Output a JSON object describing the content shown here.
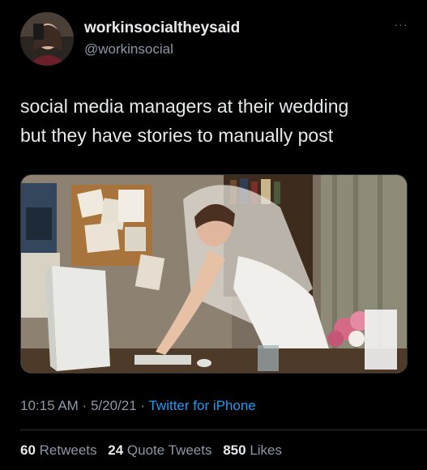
{
  "user": {
    "display_name": "workinsocialtheysaid",
    "handle": "@workinsocial",
    "avatar_icon": "profile-photo"
  },
  "more_menu": {
    "label": "···"
  },
  "tweet": {
    "text": "social media managers at their wedding\nbut they have stories to manually post"
  },
  "media": {
    "description_icon": "photo"
  },
  "meta": {
    "time": "10:15 AM",
    "separator": " · ",
    "date": "5/20/21",
    "separator2": " · ",
    "source": "Twitter for iPhone"
  },
  "stats": {
    "retweets_count": "60",
    "retweets_label": " Retweets",
    "quotes_count": "24",
    "quotes_label": " Quote Tweets",
    "likes_count": "850",
    "likes_label": " Likes"
  },
  "colors": {
    "background": "#000000",
    "text": "#e7e9ea",
    "secondary": "#8b98a5",
    "link": "#1d9bf0"
  }
}
